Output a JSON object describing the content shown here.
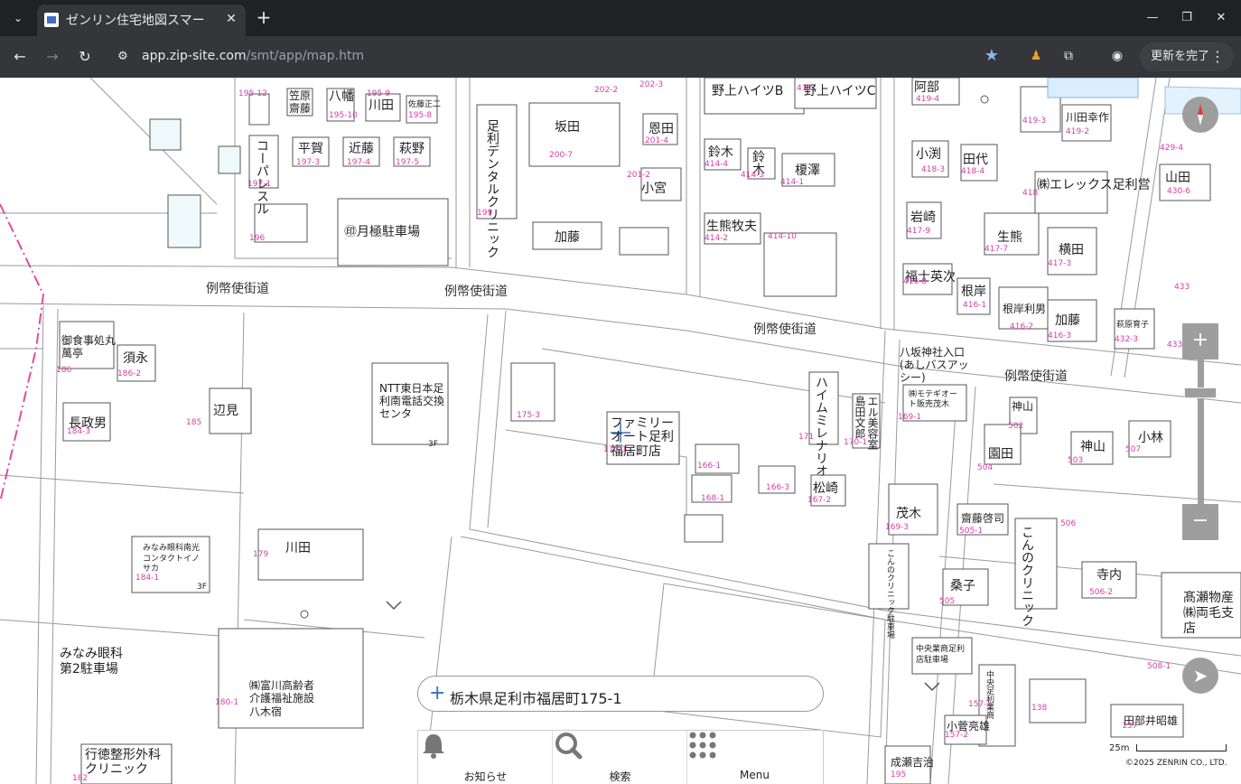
{
  "browser": {
    "tab_title": "ゼンリン住宅地図スマー",
    "tab_close": "✕",
    "new_tab": "+",
    "url_host": "app.zip-site.com",
    "url_path": "/smt/app/map.htm",
    "update_button": "更新を完了"
  },
  "map": {
    "roads": [
      "例幣使街道",
      "例幣使街道",
      "例幣使街道",
      "例幣使街道"
    ],
    "names": {
      "sahara": "笠原",
      "saito": "齋藤",
      "hachiman": "八幡",
      "kawada1": "川田",
      "satomasa": "佐藤正二",
      "hiraga": "平賀",
      "kondo": "近藤",
      "hagino": "萩野",
      "corepal": "コーパレスル",
      "tsukigoku": "㊞月極駐車場",
      "adachi_dental": "足利デンタルクリニック",
      "sakata": "坂田",
      "onda": "恩田",
      "komiya": "小宮",
      "kato1": "加藤",
      "nogami_b": "野上ハイツB",
      "nogami_c": "野上ハイツC",
      "suzuki1": "鈴木",
      "suzuki2": "鈴木",
      "enokizawa": "榎澤",
      "ikuma": "生熊牧夫",
      "abe": "阿部",
      "kobuchi": "小渕",
      "tashiro": "田代",
      "elex": "㈱エレックス足利営",
      "kawada_kotaro": "川田幸作",
      "yamada": "山田",
      "iwasaki": "岩崎",
      "ikuma2": "生熊",
      "yokota": "横田",
      "fuku": "福士英次",
      "negishi": "根岸",
      "negishi2": "根岸利男",
      "kato2": "加藤",
      "hagiwara": "萩原育子",
      "gosho": "御食事処丸萬亭",
      "sue": "須永",
      "nagasaka": "長政男",
      "henmi": "辺見",
      "ntt": "NTT東日本足利南電話交換センタ",
      "family": "ファミリーオート足利福居町店",
      "heim": "ハイムミレナリオ",
      "shimada": "島田文郎",
      "eru": "エル美容室",
      "hachisaka": "八坂神社入口(あしバスアッシー)",
      "motegi_auto": "㈱モテギオート販売茂木",
      "kamiyama1": "神山",
      "sonoda": "園田",
      "kamiyama2": "神山",
      "kobayashi": "小林",
      "matsuzaki": "松崎",
      "mogi": "茂木",
      "konno_clinic_park": "こんのクリニック駐車場",
      "saito_keishi": "齋藤啓司",
      "konno": "こんのクリニック",
      "terauchi": "寺内",
      "takase": "髙瀬物産㈱両毛支店",
      "minami_contact": "みなみ眼科南光コンタクトイノサカ",
      "kawada2": "川田",
      "minami_park": "みなみ眼科第2駐車場",
      "tomiyama": "㈱富川高齢者介護福祉施設八木宿",
      "kuwako": "桑子",
      "chuo": "中央業商足利店駐車場",
      "chuo2": "中央足利業商",
      "koizumi": "小菅亮雄",
      "tabe": "田部井昭雄",
      "gyotoku": "行徳整形外科クリニック",
      "narita": "成瀬吉治"
    },
    "numbers": [
      "195-12",
      "195-10",
      "195-9",
      "195-8",
      "197-3",
      "197-4",
      "197-5",
      "197-1",
      "196",
      "199",
      "200-7",
      "201-4",
      "201-2",
      "202-2",
      "202-3",
      "414-4",
      "414-3",
      "414-1",
      "414-2",
      "414-10",
      "417",
      "419-4",
      "419-3",
      "419-2",
      "418-3",
      "418-4",
      "418",
      "417-9",
      "417-7",
      "417-3",
      "429-4",
      "430-6",
      "416-8",
      "416-1",
      "416-2",
      "416-3",
      "432-3",
      "433",
      "433",
      "186",
      "186-2",
      "184-3",
      "185",
      "175-3",
      "175-1",
      "166-1",
      "166-3",
      "168-1",
      "167-2",
      "171",
      "170-1",
      "169-1",
      "169-3",
      "502",
      "504",
      "503",
      "507",
      "505-1",
      "506",
      "506-2",
      "505",
      "179",
      "184-1",
      "180-1",
      "138",
      "137",
      "157-2",
      "157-3",
      "195",
      "182",
      "508-1",
      "3F",
      "3F"
    ],
    "search_text": "栃木県足利市福居町175-1",
    "menu": [
      {
        "label": "お知らせ",
        "icon": "bell-icon"
      },
      {
        "label": "検索",
        "icon": "search-icon"
      },
      {
        "label": "Menu",
        "icon": "grid-icon"
      }
    ],
    "scale_label": "25m",
    "copyright": "©2025 ZENRIN CO., LTD."
  }
}
